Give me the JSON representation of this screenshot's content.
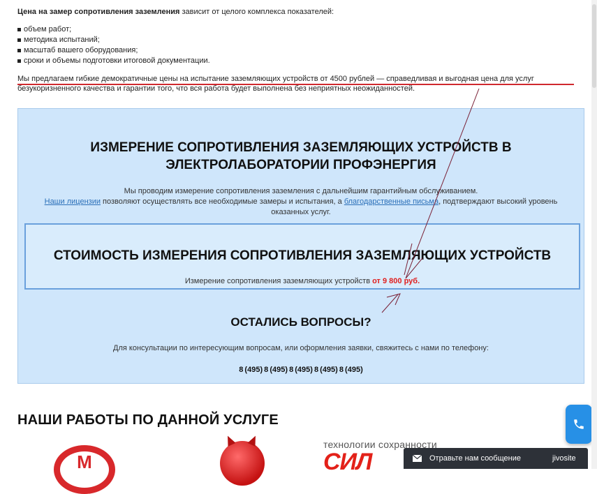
{
  "intro": {
    "lead_bold": "Цена на замер сопротивления заземления",
    "lead_rest": " зависит от целого комплекса показателей:",
    "bullets": [
      "объем работ;",
      "методика испытаний;",
      "масштаб вашего оборудования;",
      "сроки и объемы подготовки итоговой документации."
    ],
    "offer_text": "Мы предлагаем гибкие демократичные цены на испытание заземляющих устройств от 4500 рублей — справедливая и выгодная цена для услуг безукоризненного качества и гарантии того, что вся работа будет выполнена без неприятных неожиданностей."
  },
  "panel": {
    "title_line1": "ИЗМЕРЕНИЕ СОПРОТИВЛЕНИЯ ЗАЗЕМЛЯЮЩИХ УСТРОЙСТВ В",
    "title_line2": "ЭЛЕКТРОЛАБОРАТОРИИ ПРОФЭНЕРГИЯ",
    "text_line1": "Мы проводим измерение сопротивления заземления с дальнейшим гарантийным обслуживанием.",
    "licenses_link": "Наши лицензии",
    "text_mid": " позволяют осуществлять все необходимые замеры и испытания, а ",
    "letters_link": "благодарственные письма",
    "text_end": ", подтверждают высокий уровень оказанных услуг."
  },
  "price_box": {
    "title": "СТОИМОСТЬ ИЗМЕРЕНИЯ СОПРОТИВЛЕНИЯ ЗАЗЕМЛЯЮЩИХ УСТРОЙСТВ",
    "text": "Измерение сопротивления заземляющих устройств ",
    "price": "от 9 800 руб."
  },
  "questions": {
    "title": "ОСТАЛИСЬ ВОПРОСЫ?",
    "text": "Для консультации по интересующим вопросам, или оформления заявки, свяжитесь с нами по телефону:",
    "phones": "8 (495) 8 (495) 8 (495) 8 (495) 8 (495)"
  },
  "works": {
    "title": "НАШИ РАБОТЫ ПО ДАННОЙ УСЛУГЕ",
    "logo3_tagline": "технологии сохранности",
    "logo3_name": "СИЛ"
  },
  "widgets": {
    "call_icon": "phone-icon",
    "chat_message": "Отравьте нам сообщение",
    "chat_brand": "jivosite",
    "chat_icon": "envelope-icon"
  },
  "colors": {
    "panel_bg": "#cfe6fb",
    "accent_red": "#e0201f",
    "link_blue": "#2a6fb8",
    "call_button": "#2790e6",
    "chat_bar": "#2d3138"
  }
}
